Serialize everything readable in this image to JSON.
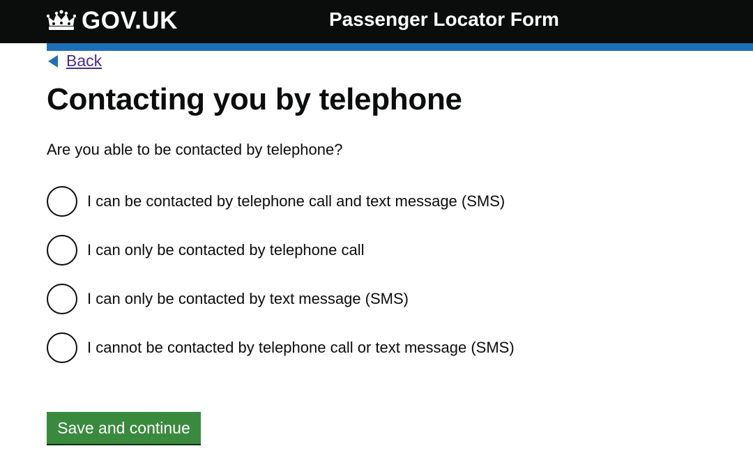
{
  "header": {
    "logo_text": "GOV.UK",
    "service_name": "Passenger Locator Form",
    "logo_icon": "crown-icon"
  },
  "nav": {
    "back_label": "Back",
    "back_icon": "triangle-left-icon"
  },
  "page": {
    "title": "Contacting you by telephone",
    "question": "Are you able to be contacted by telephone?",
    "options": [
      {
        "label": "I can be contacted by telephone call and text message (SMS)",
        "selected": false
      },
      {
        "label": "I can only be contacted by telephone call",
        "selected": false
      },
      {
        "label": "I can only be contacted by text message (SMS)",
        "selected": false
      },
      {
        "label": "I cannot be contacted by telephone call or text message (SMS)",
        "selected": false
      }
    ],
    "submit_label": "Save and continue"
  },
  "colors": {
    "header_bg": "#0b0c0c",
    "accent_bar": "#1d70b8",
    "link": "#4c2c92",
    "button": "#3a8a3e"
  }
}
